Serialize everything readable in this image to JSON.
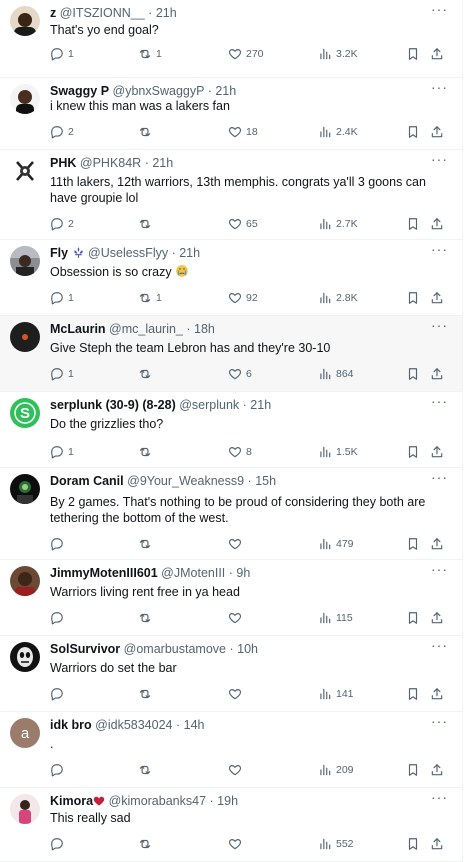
{
  "tweets": [
    {
      "name": "z",
      "handle": "@ITSZIONN__",
      "sep": "·",
      "time": "21h",
      "text": "That's yo end goal?",
      "replies": "1",
      "reposts": "1",
      "likes": "270",
      "views": "3.2K"
    },
    {
      "name": "Swaggy P",
      "handle": "@ybnxSwaggyP",
      "sep": "·",
      "time": "21h",
      "text": "i knew this man was a lakers fan",
      "replies": "2",
      "reposts": "",
      "likes": "18",
      "views": "2.4K"
    },
    {
      "name": "PHK",
      "handle": "@PHK84R",
      "sep": "·",
      "time": "21h",
      "text": "11th lakers, 12th warriors, 13th memphis. congrats ya'll 3 goons can have groupie lol",
      "replies": "2",
      "reposts": "",
      "likes": "65",
      "views": "2.7K"
    },
    {
      "name": "Fly",
      "handle": "@UselessFlyy",
      "sep": "·",
      "time": "21h",
      "text": "Obsession is so crazy",
      "replies": "1",
      "reposts": "1",
      "likes": "92",
      "views": "2.8K"
    },
    {
      "name": "McLaurin",
      "handle": "@mc_laurin_",
      "sep": "·",
      "time": "18h",
      "text": "Give Steph the team Lebron has and they're  30-10",
      "replies": "1",
      "reposts": "",
      "likes": "6",
      "views": "864"
    },
    {
      "name": "serplunk (30-9) (8-28)",
      "handle": "@serplunk",
      "sep": "·",
      "time": "21h",
      "text": "Do the grizzlies tho?",
      "replies": "1",
      "reposts": "",
      "likes": "8",
      "views": "1.5K"
    },
    {
      "name": "Doram Canil",
      "handle": "@9Your_Weakness9",
      "sep": "·",
      "time": "15h",
      "text": "By 2 games. That's nothing to be proud of considering they both are tethering the bottom of the west.",
      "replies": "",
      "reposts": "",
      "likes": "",
      "views": "479"
    },
    {
      "name": "JimmyMotenIII601",
      "handle": "@JMotenIII",
      "sep": "·",
      "time": "9h",
      "text": "Warriors living rent free in ya head",
      "replies": "",
      "reposts": "",
      "likes": "",
      "views": "115"
    },
    {
      "name": "SolSurvivor",
      "handle": "@omarbustamove",
      "sep": "·",
      "time": "10h",
      "text": "Warriors do set the bar",
      "replies": "",
      "reposts": "",
      "likes": "",
      "views": "141"
    },
    {
      "name": "idk bro",
      "handle": "@idk5834024",
      "sep": "·",
      "time": "14h",
      "text": ".",
      "replies": "",
      "reposts": "",
      "likes": "",
      "views": "209"
    },
    {
      "name": "Kimora",
      "handle": "@kimorabanks47",
      "sep": "·",
      "time": "19h",
      "text": "This really sad",
      "replies": "",
      "reposts": "",
      "likes": "",
      "views": "552"
    }
  ],
  "avatar_letter_idk": "a",
  "more_glyph": "···",
  "colors": {
    "icon": "#536471",
    "text": "#0f1419",
    "divider": "#eff3f4",
    "highlight_bg": "#f7f7f7",
    "serplunk_green": "#2fbf5b",
    "heart_red": "#c81e3c",
    "fleur_blue": "#4a55c8"
  },
  "icons": [
    "reply-icon",
    "repost-icon",
    "like-icon",
    "views-icon",
    "bookmark-icon",
    "share-icon",
    "more-icon",
    "fleur-de-lis-icon",
    "heart-emoji-icon",
    "crying-emoji-icon"
  ]
}
